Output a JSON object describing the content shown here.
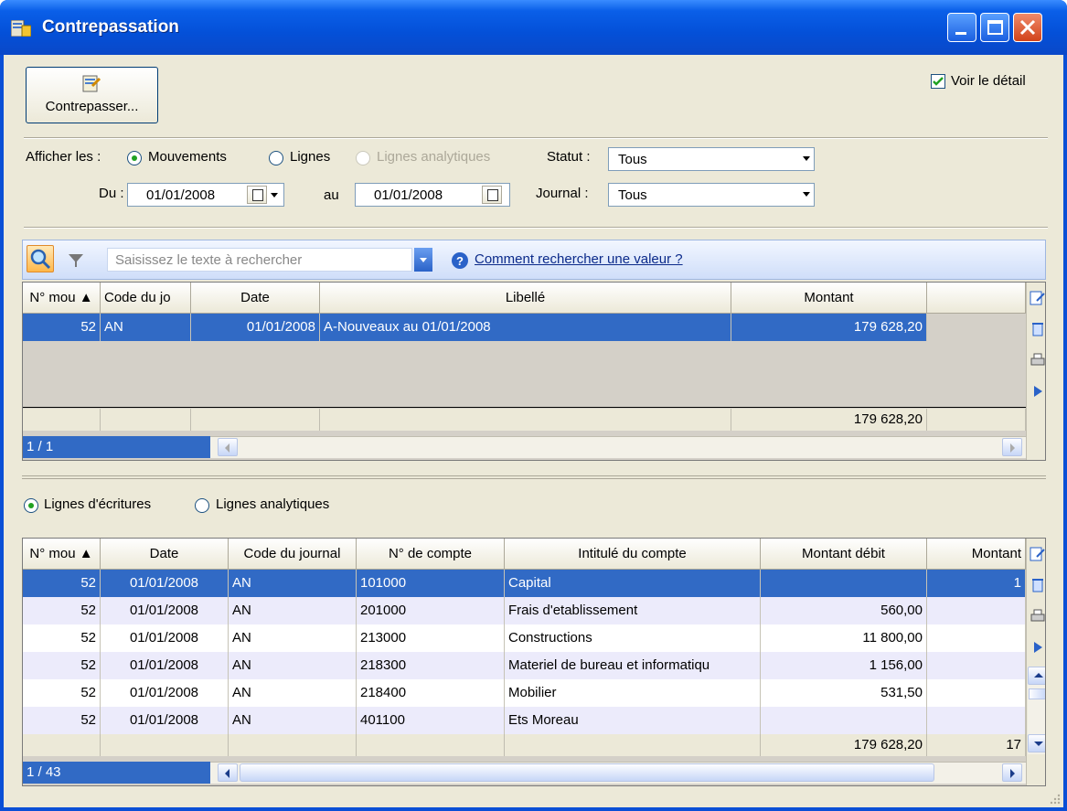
{
  "window": {
    "title": "Contrepassation"
  },
  "toolbar": {
    "contrepasser_label": "Contrepasser..."
  },
  "voir_detail": {
    "label": "Voir le détail",
    "checked": true
  },
  "filters": {
    "afficher_label": "Afficher les :",
    "radio_mouvements": "Mouvements",
    "radio_lignes": "Lignes",
    "radio_lignes_analytiques": "Lignes analytiques",
    "statut_label": "Statut :",
    "statut_value": "Tous",
    "du_label": "Du :",
    "du_value": "01/01/2008",
    "au_label": "au",
    "au_value": "01/01/2008",
    "journal_label": "Journal :",
    "journal_value": "Tous"
  },
  "search": {
    "placeholder": "Saisissez le texte à rechercher",
    "help_link": "Comment rechercher une valeur ?"
  },
  "top_grid": {
    "columns": [
      "N° mou",
      "Code du jo",
      "Date",
      "Libellé",
      "Montant"
    ],
    "rows": [
      {
        "num": "52",
        "code": "AN",
        "date": "01/01/2008",
        "libelle": "A-Nouveaux au 01/01/2008",
        "montant": "179 628,20"
      }
    ],
    "total_montant": "179 628,20",
    "pager": "1 / 1"
  },
  "detail_toggle": {
    "lignes_ecritures": "Lignes d'écritures",
    "lignes_analytiques": "Lignes analytiques"
  },
  "bottom_grid": {
    "columns": [
      "N° mou",
      "Date",
      "Code du journal",
      "N° de compte",
      "Intitulé du compte",
      "Montant débit",
      "Montant"
    ],
    "rows": [
      {
        "num": "52",
        "date": "01/01/2008",
        "journal": "AN",
        "compte": "101000",
        "intitule": "Capital",
        "debit": "",
        "credit": "1"
      },
      {
        "num": "52",
        "date": "01/01/2008",
        "journal": "AN",
        "compte": "201000",
        "intitule": "Frais d'etablissement",
        "debit": "560,00",
        "credit": ""
      },
      {
        "num": "52",
        "date": "01/01/2008",
        "journal": "AN",
        "compte": "213000",
        "intitule": "Constructions",
        "debit": "11 800,00",
        "credit": ""
      },
      {
        "num": "52",
        "date": "01/01/2008",
        "journal": "AN",
        "compte": "218300",
        "intitule": "Materiel de bureau et informatiqu",
        "debit": "1 156,00",
        "credit": ""
      },
      {
        "num": "52",
        "date": "01/01/2008",
        "journal": "AN",
        "compte": "218400",
        "intitule": "Mobilier",
        "debit": "531,50",
        "credit": ""
      },
      {
        "num": "52",
        "date": "01/01/2008",
        "journal": "AN",
        "compte": "401100",
        "intitule": "Ets Moreau",
        "debit": "",
        "credit": ""
      }
    ],
    "total_debit": "179 628,20",
    "total_credit": "17",
    "pager": "1 / 43"
  }
}
